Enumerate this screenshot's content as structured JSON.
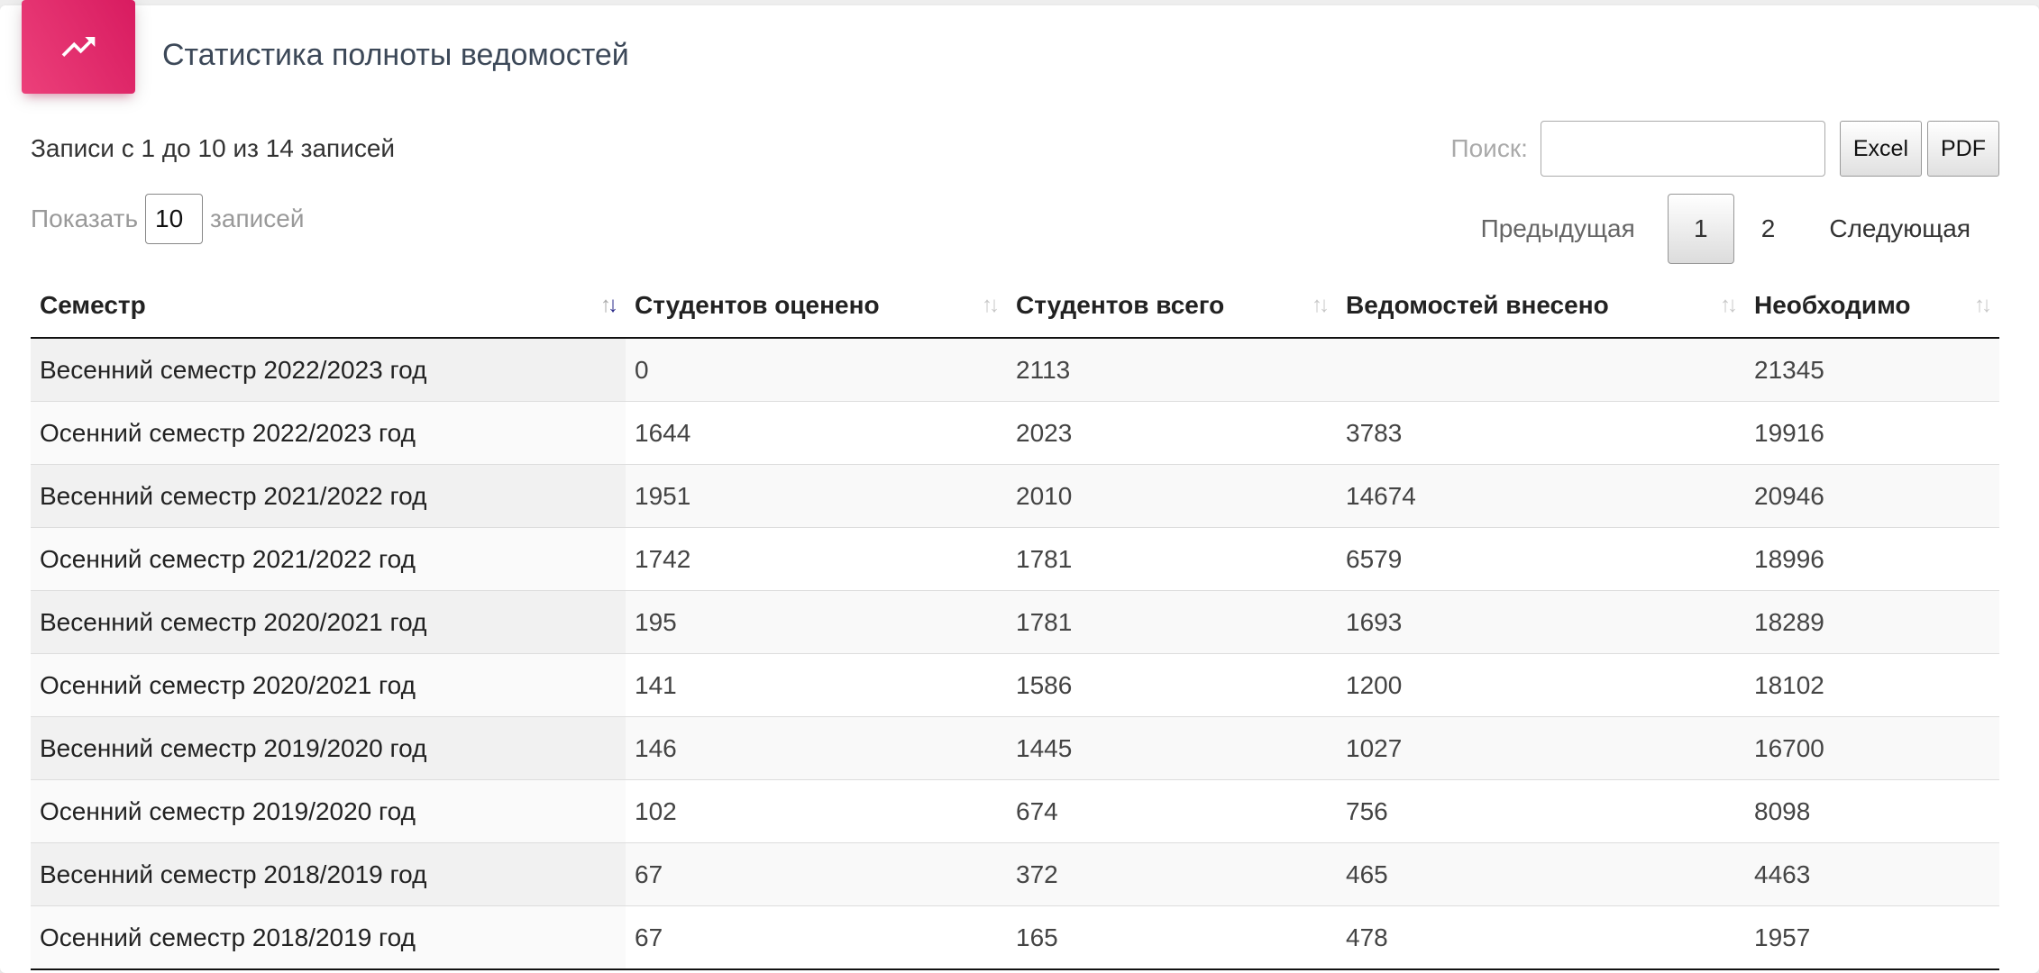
{
  "card": {
    "icon": "trending-up-icon",
    "accent_color": "#e91e63",
    "title": "Статистика полноты ведомостей"
  },
  "info": {
    "text": "Записи с 1 до 10 из 14 записей"
  },
  "length": {
    "prefix": "Показать",
    "value": "10",
    "suffix": "записей"
  },
  "search": {
    "label": "Поиск:",
    "value": ""
  },
  "export": {
    "excel_label": "Excel",
    "pdf_label": "PDF"
  },
  "pagination": {
    "prev_label": "Предыдущая",
    "pages": [
      "1",
      "2"
    ],
    "current": "1",
    "next_label": "Следующая"
  },
  "table": {
    "columns": [
      {
        "label": "Семестр",
        "sort": "desc-active"
      },
      {
        "label": "Студентов оценено",
        "sort": "none"
      },
      {
        "label": "Студентов всего",
        "sort": "none"
      },
      {
        "label": "Ведомостей внесено",
        "sort": "none"
      },
      {
        "label": "Необходимо",
        "sort": "none"
      }
    ],
    "rows": [
      [
        "Весенний семестр 2022/2023 год",
        "0",
        "2113",
        "",
        "21345"
      ],
      [
        "Осенний семестр 2022/2023 год",
        "1644",
        "2023",
        "3783",
        "19916"
      ],
      [
        "Весенний семестр 2021/2022 год",
        "1951",
        "2010",
        "14674",
        "20946"
      ],
      [
        "Осенний семестр 2021/2022 год",
        "1742",
        "1781",
        "6579",
        "18996"
      ],
      [
        "Весенний семестр 2020/2021 год",
        "195",
        "1781",
        "1693",
        "18289"
      ],
      [
        "Осенний семестр 2020/2021 год",
        "141",
        "1586",
        "1200",
        "18102"
      ],
      [
        "Весенний семестр 2019/2020 год",
        "146",
        "1445",
        "1027",
        "16700"
      ],
      [
        "Осенний семестр 2019/2020 год",
        "102",
        "674",
        "756",
        "8098"
      ],
      [
        "Весенний семестр 2018/2019 год",
        "67",
        "372",
        "465",
        "4463"
      ],
      [
        "Осенний семестр 2018/2019 год",
        "67",
        "165",
        "478",
        "1957"
      ]
    ]
  }
}
